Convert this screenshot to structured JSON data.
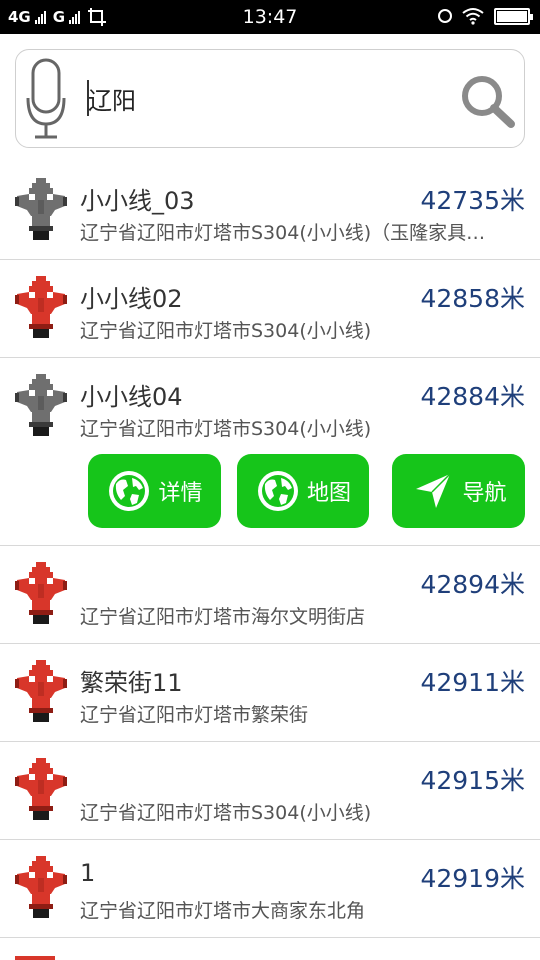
{
  "status_bar": {
    "network": "4G",
    "carrier2": "G",
    "time": "13:47"
  },
  "search": {
    "value": "辽阳",
    "placeholder": ""
  },
  "results": [
    {
      "name": "小小线_03",
      "address": "辽宁省辽阳市灯塔市S304(小小线)（玉隆家具…",
      "distance": "42735米",
      "icon_color": "gray"
    },
    {
      "name": "小小线02",
      "address": "辽宁省辽阳市灯塔市S304(小小线)",
      "distance": "42858米",
      "icon_color": "red"
    },
    {
      "name": "小小线04",
      "address": "辽宁省辽阳市灯塔市S304(小小线)",
      "distance": "42884米",
      "icon_color": "gray"
    },
    {
      "name": "",
      "address": "辽宁省辽阳市灯塔市海尔文明街店",
      "distance": "42894米",
      "icon_color": "red"
    },
    {
      "name": "繁荣街11",
      "address": "辽宁省辽阳市灯塔市繁荣街",
      "distance": "42911米",
      "icon_color": "red"
    },
    {
      "name": "",
      "address": "辽宁省辽阳市灯塔市S304(小小线)",
      "distance": "42915米",
      "icon_color": "red"
    },
    {
      "name": "1",
      "address": "辽宁省辽阳市灯塔市大商家东北角",
      "distance": "42919米",
      "icon_color": "red"
    }
  ],
  "actions": {
    "details_label": "详情",
    "map_label": "地图",
    "navigate_label": "导航"
  },
  "colors": {
    "action_green": "#16c51a",
    "distance_blue": "#1f3f7a",
    "hydrant_red": "#d8362a",
    "hydrant_gray": "#6f6f6f"
  }
}
